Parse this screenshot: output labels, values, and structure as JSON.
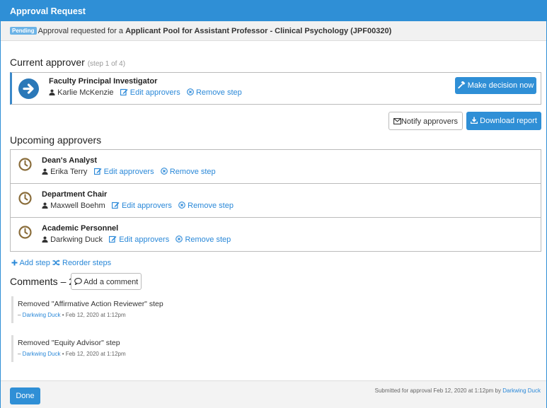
{
  "header": {
    "title": "Approval Request"
  },
  "status": {
    "badge": "Pending",
    "prefix": "Approval requested for a ",
    "subject": "Applicant Pool for Assistant Professor - Clinical Psychology (JPF00320)"
  },
  "current": {
    "heading": "Current approver",
    "step": "(step 1 of 4)",
    "title": "Faculty Principal Investigator",
    "person": "Karlie McKenzie",
    "edit_label": "Edit approvers",
    "remove_label": "Remove step",
    "decision_label": "Make decision now"
  },
  "actions": {
    "notify_label": "Notify approvers",
    "download_label": "Download report"
  },
  "upcoming": {
    "heading": "Upcoming approvers",
    "items": [
      {
        "title": "Dean's Analyst",
        "person": "Erika Terry"
      },
      {
        "title": "Department Chair",
        "person": "Maxwell Boehm"
      },
      {
        "title": "Academic Personnel",
        "person": "Darkwing Duck"
      }
    ],
    "edit_label": "Edit approvers",
    "remove_label": "Remove step"
  },
  "steps": {
    "add_label": "Add step",
    "reorder_label": "Reorder steps"
  },
  "comments": {
    "heading": "Comments – 2",
    "add_label": "Add a comment",
    "items": [
      {
        "text": "Removed \"Affirmative Action Reviewer\" step",
        "author": "Darkwing Duck",
        "time": " • Feb 12, 2020 at 1:12pm"
      },
      {
        "text": "Removed \"Equity Advisor\" step",
        "author": "Darkwing Duck",
        "time": " • Feb 12, 2020 at 1:12pm"
      }
    ]
  },
  "footer": {
    "done_label": "Done",
    "submitted_prefix": "Submitted for approval Feb 12, 2020 at 1:12pm by ",
    "submitted_by": "Darkwing Duck"
  },
  "colors": {
    "accent": "#2f8fd6",
    "clock": "#8a6d3b",
    "link": "#2a88d8"
  }
}
